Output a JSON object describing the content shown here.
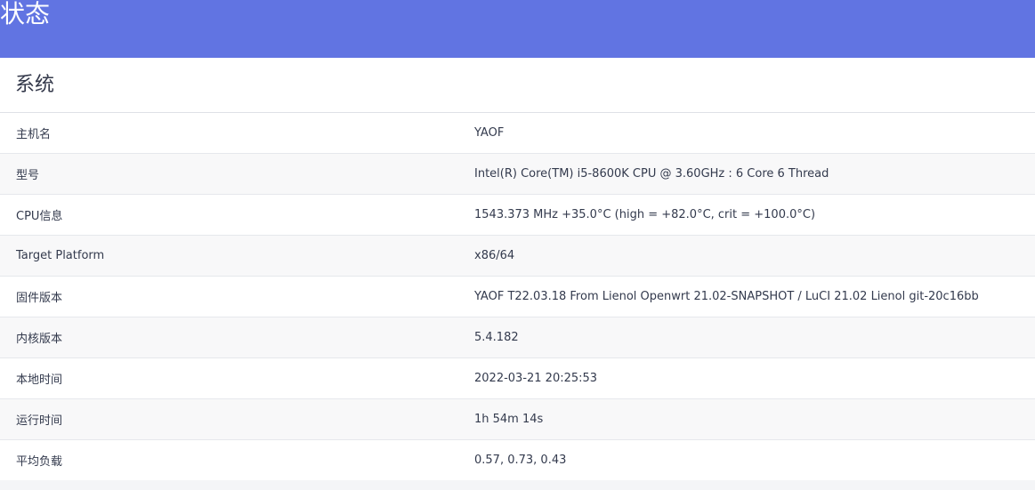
{
  "header": {
    "title": "状态"
  },
  "system": {
    "title": "系统",
    "rows": [
      {
        "label": "主机名",
        "value": "YAOF"
      },
      {
        "label": "型号",
        "value": "Intel(R) Core(TM) i5-8600K CPU @ 3.60GHz : 6 Core 6 Thread"
      },
      {
        "label": "CPU信息",
        "value": "1543.373 MHz +35.0°C (high = +82.0°C, crit = +100.0°C)"
      },
      {
        "label": "Target Platform",
        "value": "x86/64"
      },
      {
        "label": "固件版本",
        "value": "YAOF T22.03.18 From Lienol Openwrt 21.02-SNAPSHOT / LuCI 21.02 Lienol git-20c16bb"
      },
      {
        "label": "内核版本",
        "value": "5.4.182"
      },
      {
        "label": "本地时间",
        "value": "2022-03-21 20:25:53"
      },
      {
        "label": "运行时间",
        "value": "1h 54m 14s"
      },
      {
        "label": "平均负载",
        "value": "0.57, 0.73, 0.43"
      }
    ]
  }
}
